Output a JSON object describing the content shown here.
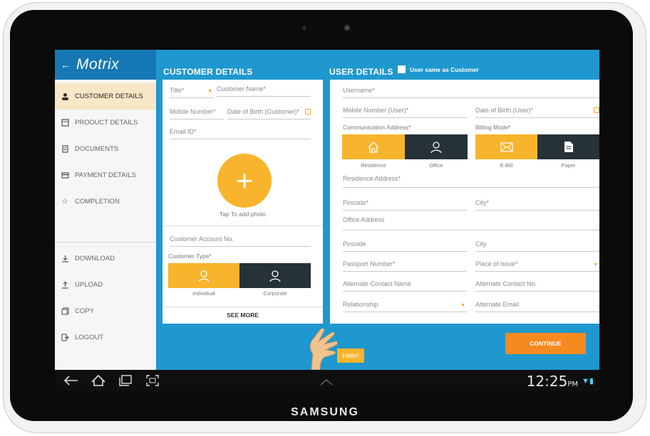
{
  "device_brand": "SAMSUNG",
  "app": {
    "logo": "Motrix",
    "back_icon": "back-arrow-icon"
  },
  "sidebar": {
    "items": [
      {
        "label": "CUSTOMER DETAILS",
        "icon": "person-icon"
      },
      {
        "label": "PRODUCT DETAILS",
        "icon": "product-icon"
      },
      {
        "label": "DOCUMENTS",
        "icon": "documents-icon"
      },
      {
        "label": "PAYMENT DETAILS",
        "icon": "payment-icon"
      },
      {
        "label": "COMPLETION",
        "icon": "star-icon"
      }
    ],
    "actions": [
      {
        "label": "DOWNLOAD",
        "icon": "download-icon"
      },
      {
        "label": "UPLOAD",
        "icon": "upload-icon"
      },
      {
        "label": "COPY",
        "icon": "copy-icon"
      },
      {
        "label": "LOGOUT",
        "icon": "logout-icon"
      }
    ]
  },
  "customer": {
    "title": "CUSTOMER DETAILS",
    "fields": {
      "title": "Title*",
      "name": "Customer Name*",
      "mobile": "Mobile Number*",
      "dob": "Date of Birth (Customer)*",
      "email": "Email ID*",
      "account": "Customer Account No."
    },
    "photo_label": "Tap To add photo",
    "type_label": "Customer Type*",
    "type_options": [
      "Individual",
      "Corporate"
    ],
    "see_more": "SEE MORE"
  },
  "user": {
    "title": "USER DETAILS",
    "same_as_customer": "User same as Customer",
    "fields": {
      "username": "Username*",
      "mobile": "Mobile Number (User)*",
      "dob": "Date of Birth (User)*",
      "comm_address": "Communication Address*",
      "billing_mode": "Billing Mode*",
      "residence_address": "Residence Address*",
      "pincode": "Pincode*",
      "city": "City*",
      "office_address": "Office Address",
      "pincode2": "Pincode",
      "city2": "City",
      "passport": "Passport Number*",
      "place_of_issue": "Place of issue*",
      "alt_contact_name": "Alternate Contact Name",
      "alt_contact_no": "Alternate Contact No.",
      "relationship": "Relationship",
      "alt_email": "Alternate Email"
    },
    "address_options": [
      "Residence",
      "Office"
    ],
    "billing_options": [
      "E-Bill",
      "Paper"
    ]
  },
  "continue_label": "CONTINUE",
  "hello_label": "Hello!",
  "status": {
    "time": "12:25",
    "ampm": "PM"
  },
  "colors": {
    "accent": "#f7b42c",
    "primary": "#1f98cf",
    "dark": "#263238",
    "continue": "#f58a1f"
  }
}
